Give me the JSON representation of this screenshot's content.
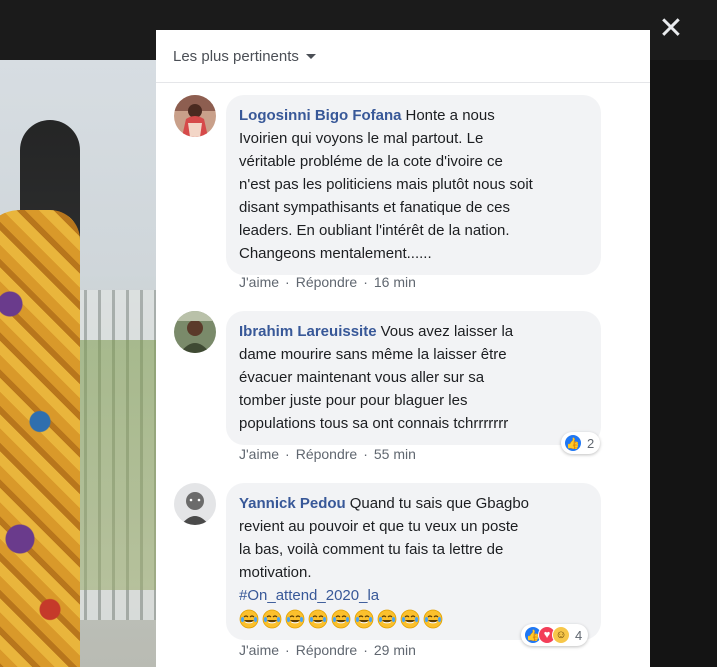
{
  "sort": {
    "label": "Les plus pertinents"
  },
  "close": {
    "glyph": "✕"
  },
  "comments": [
    {
      "author": "Logosinni Bigo Fofana",
      "lines": [
        "Honte a nous",
        "Ivoirien qui voyons le mal partout. Le",
        "véritable probléme de la cote d'ivoire ce",
        "n'est pas les politiciens mais plutôt nous soit",
        "disant sympathisants et fanatique de ces",
        "leaders. En oubliant l'intérêt de la nation.",
        "Changeons mentalement......"
      ],
      "like": "J'aime",
      "reply": "Répondre",
      "time": "16 min"
    },
    {
      "author": "Ibrahim Lareuissite",
      "lines": [
        "Vous avez laisser la",
        "dame mourire sans même la laisser être",
        "évacuer maintenant vous aller sur sa",
        "tomber juste pour pour blaguer les",
        "populations tous sa ont connais tchrrrrrrr"
      ],
      "like": "J'aime",
      "reply": "Répondre",
      "time": "55 min",
      "reaction_count": "2"
    },
    {
      "author": "Yannick Pedou",
      "lines": [
        "Quand tu sais que Gbagbo",
        "revient au pouvoir et que tu veux un poste",
        "la bas, voilà comment tu fais ta lettre de",
        "motivation."
      ],
      "hashtag": "#On_attend_2020_la",
      "emoji_count": 9,
      "like": "J'aime",
      "reply": "Répondre",
      "time": "29 min",
      "reaction_count": "4"
    }
  ]
}
